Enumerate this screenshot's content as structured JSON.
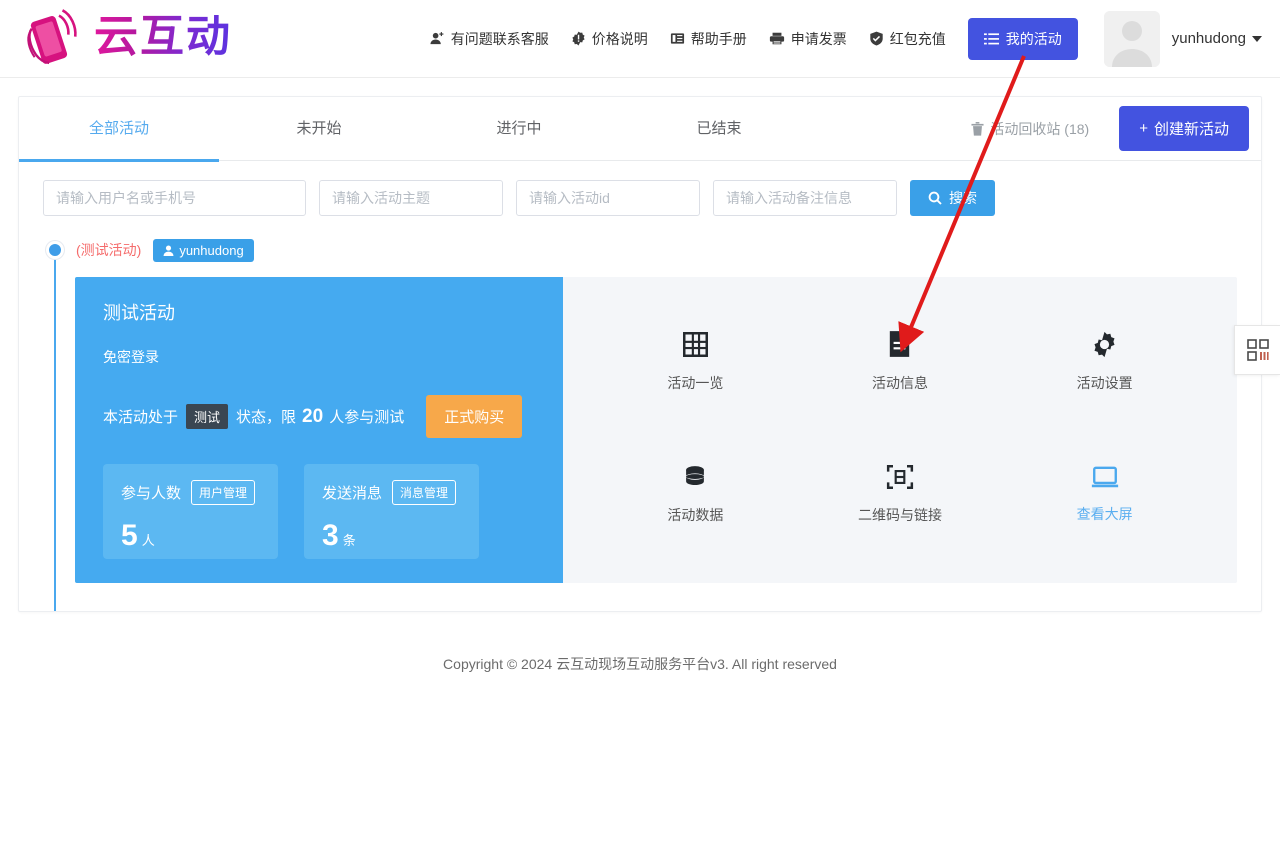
{
  "header": {
    "logo_text": "云互动",
    "logo_icon": "phone-logo-icon",
    "nav": [
      {
        "label": "有问题联系客服",
        "icon": "contact-support-icon"
      },
      {
        "label": "价格说明",
        "icon": "price-info-icon"
      },
      {
        "label": "帮助手册",
        "icon": "manual-book-icon"
      },
      {
        "label": "申请发票",
        "icon": "printer-invoice-icon"
      },
      {
        "label": "红包充值",
        "icon": "shield-recharge-icon"
      }
    ],
    "my_activity_button": "我的活动",
    "my_activity_icon": "list-icon",
    "user_name": "yunhudong",
    "avatar_icon": "user-avatar-placeholder"
  },
  "tabs": [
    {
      "label": "全部活动",
      "active": true
    },
    {
      "label": "未开始",
      "active": false
    },
    {
      "label": "进行中",
      "active": false
    },
    {
      "label": "已结束",
      "active": false
    }
  ],
  "toolbar": {
    "recycle_label": "活动回收站 (18)",
    "recycle_icon": "trash-icon",
    "create_label": "创建新活动",
    "create_prefix": "+"
  },
  "filters": {
    "inputs": [
      {
        "placeholder": "请输入用户名或手机号",
        "value": "",
        "width": "wide"
      },
      {
        "placeholder": "请输入活动主题",
        "value": "",
        "width": "narrow"
      },
      {
        "placeholder": "请输入活动id",
        "value": "",
        "width": "narrow"
      },
      {
        "placeholder": "请输入活动备注信息",
        "value": "",
        "width": "narrow"
      }
    ],
    "search_label": "搜索",
    "search_icon": "search-icon"
  },
  "activity": {
    "title_note": "(测试活动)",
    "owner_tag": "yunhudong",
    "owner_tag_icon": "user-icon",
    "name": "测试活动",
    "login_mode": "免密登录",
    "status_prefix": "本活动处于",
    "status_chip": "测试",
    "status_middle": "状态，限",
    "status_limit": "20",
    "status_suffix": "人参与测试",
    "buy_button": "正式购买",
    "stats": [
      {
        "label": "参与人数",
        "action": "用户管理",
        "value": "5",
        "unit": "人"
      },
      {
        "label": "发送消息",
        "action": "消息管理",
        "value": "3",
        "unit": "条"
      }
    ],
    "modules": [
      {
        "label": "活动一览",
        "icon": "grid-icon",
        "highlight": false
      },
      {
        "label": "活动信息",
        "icon": "document-icon",
        "highlight": false
      },
      {
        "label": "活动设置",
        "icon": "gear-icon",
        "highlight": false
      },
      {
        "label": "活动数据",
        "icon": "database-icon",
        "highlight": false
      },
      {
        "label": "二维码与链接",
        "icon": "scan-code-icon",
        "highlight": false
      },
      {
        "label": "查看大屏",
        "icon": "monitor-icon",
        "highlight": true
      }
    ]
  },
  "float_button": {
    "icon": "qrcode-icon"
  },
  "footer": {
    "text": "Copyright © 2024 云互动现场互动服务平台v3. All right reserved"
  },
  "colors": {
    "primary_blue": "#4353e0",
    "accent_blue": "#3aa0e8",
    "card_blue": "#45aaf0",
    "orange": "#f7a84a",
    "red_note": "#f56c6c",
    "annotation_red": "#e01b1b"
  }
}
